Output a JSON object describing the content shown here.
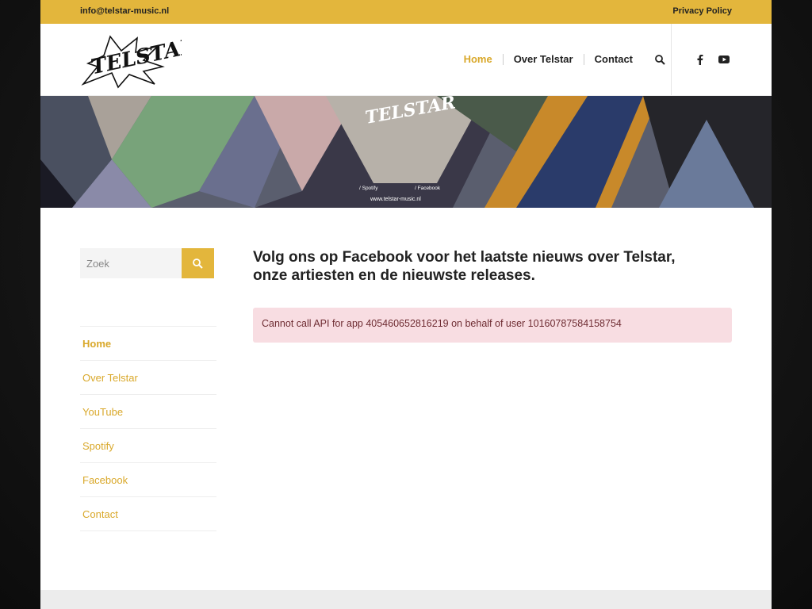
{
  "topbar": {
    "email": "info@telstar-music.nl",
    "privacy": "Privacy Policy"
  },
  "header": {
    "logo_text": "TELSTAR",
    "nav": [
      {
        "label": "Home",
        "active": true
      },
      {
        "label": "Over Telstar",
        "active": false
      },
      {
        "label": "Contact",
        "active": false
      }
    ],
    "search_icon": "search-icon",
    "social": [
      "facebook-icon",
      "youtube-icon"
    ]
  },
  "banner": {
    "logo_text": "TELSTAR",
    "spotify": "/ Spotify",
    "facebook": "/ Facebook",
    "url": "www.telstar-music.nl"
  },
  "sidebar": {
    "search_placeholder": "Zoek",
    "items": [
      {
        "label": "Home",
        "active": true
      },
      {
        "label": "Over Telstar",
        "active": false
      },
      {
        "label": "YouTube",
        "active": false
      },
      {
        "label": "Spotify",
        "active": false
      },
      {
        "label": "Facebook",
        "active": false
      },
      {
        "label": "Contact",
        "active": false
      }
    ]
  },
  "main": {
    "title": "Volg ons op Facebook voor het laatste nieuws over Telstar, onze artiesten en de nieuwste releases.",
    "alert": "Cannot call API for app 405460652816219 on behalf of user 10160787584158754"
  },
  "colors": {
    "accent": "#e3b63c",
    "link": "#d9a82a",
    "alert_bg": "#f8dde2",
    "alert_text": "#6e2c32"
  }
}
